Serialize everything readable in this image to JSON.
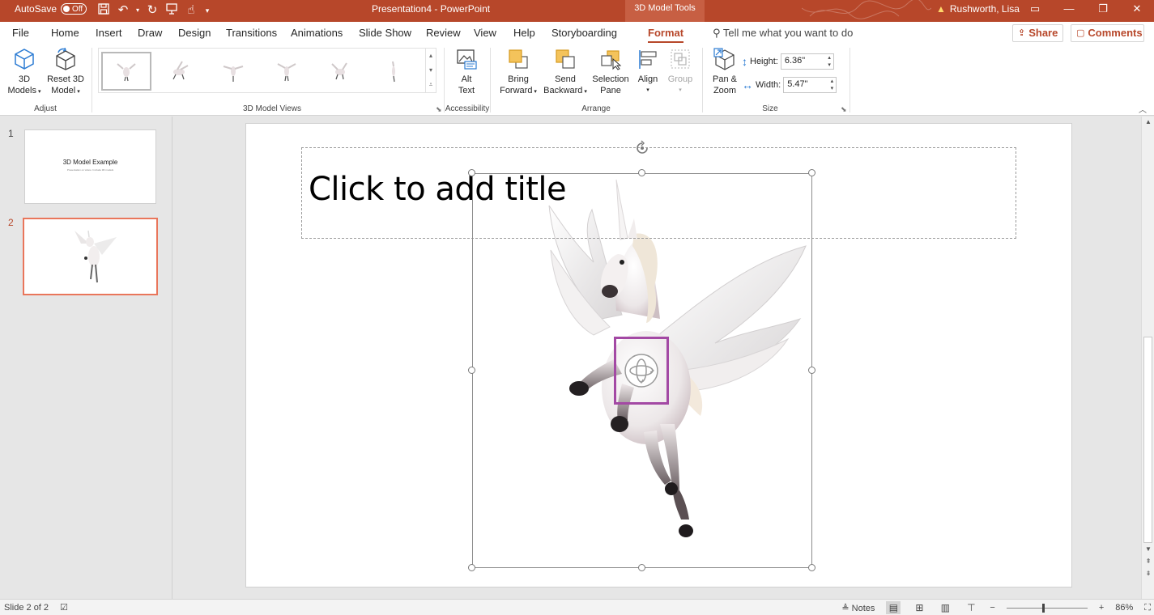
{
  "titlebar": {
    "autosave_label": "AutoSave",
    "autosave_state": "Off",
    "document_title": "Presentation4  -  PowerPoint",
    "contextual_tab": "3D Model Tools",
    "user_name": "Rushworth, Lisa"
  },
  "menu": {
    "tabs": [
      {
        "label": "File"
      },
      {
        "label": "Home"
      },
      {
        "label": "Insert"
      },
      {
        "label": "Draw"
      },
      {
        "label": "Design"
      },
      {
        "label": "Transitions"
      },
      {
        "label": "Animations"
      },
      {
        "label": "Slide Show"
      },
      {
        "label": "Review"
      },
      {
        "label": "View"
      },
      {
        "label": "Help"
      },
      {
        "label": "Storyboarding"
      },
      {
        "label": "Format",
        "active": true
      }
    ],
    "tell_me": "Tell me what you want to do",
    "share": "Share",
    "comments": "Comments"
  },
  "ribbon": {
    "adjust": {
      "label": "Adjust",
      "models_l1": "3D",
      "models_l2": "Models",
      "reset_l1": "Reset 3D",
      "reset_l2": "Model"
    },
    "views": {
      "label": "3D Model Views"
    },
    "accessibility": {
      "label": "Accessibility",
      "alt_l1": "Alt",
      "alt_l2": "Text"
    },
    "arrange": {
      "label": "Arrange",
      "bring_l1": "Bring",
      "bring_l2": "Forward",
      "send_l1": "Send",
      "send_l2": "Backward",
      "sel_l1": "Selection",
      "sel_l2": "Pane",
      "align": "Align",
      "group": "Group"
    },
    "size": {
      "label": "Size",
      "pan_l1": "Pan &",
      "pan_l2": "Zoom",
      "height_label": "Height:",
      "height_value": "6.36\"",
      "width_label": "Width:",
      "width_value": "5.47\""
    }
  },
  "slides": [
    {
      "number": "1",
      "title": "3D Model Example",
      "subtitle": "Presentation on where I include 3D models"
    },
    {
      "number": "2",
      "active": true
    }
  ],
  "canvas": {
    "title_placeholder": "Click to add title"
  },
  "status": {
    "slide_info": "Slide 2 of 2",
    "notes": "Notes",
    "zoom": "86%",
    "zoom_fraction": 0.46
  },
  "colors": {
    "accent": "#b7472a",
    "selection_box": "#a349a4"
  }
}
